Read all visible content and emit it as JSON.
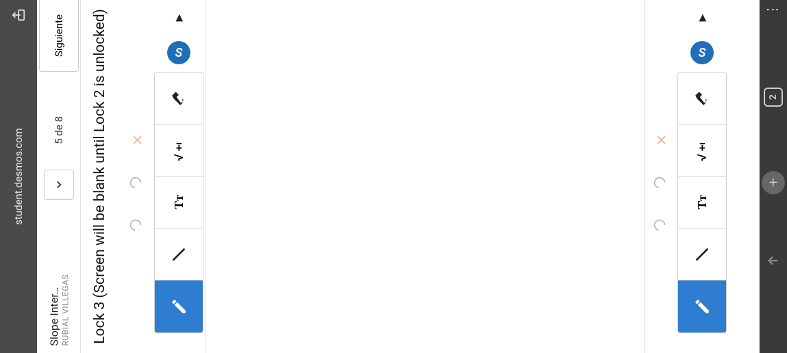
{
  "browser": {
    "url": "student.desmos.com",
    "share_icon": "share-icon"
  },
  "header": {
    "activity_title": "Slope Inter…",
    "teacher_name": "RUBIAL VILLEGAS",
    "page_count": "5 de 8",
    "next_label": "Siguiente",
    "chevron_icon": "chevron-down",
    "menu_icon": "more-dots"
  },
  "screen": {
    "title": "Lock 3 (Screen will be blank until Lock 2 is unlocked)"
  },
  "sketch_controls": {
    "close_icon": "close-x",
    "undo_icon": "undo-arc",
    "redo_icon": "redo-arc",
    "sketch_badge": "S",
    "play_icon": "play-triangle"
  },
  "toolbar": {
    "tools": [
      {
        "id": "eraser",
        "icon": "eraser-icon",
        "active": false
      },
      {
        "id": "math",
        "icon": "sqrt-pm-icon",
        "active": false
      },
      {
        "id": "text",
        "icon": "text-tt-icon",
        "active": false
      },
      {
        "id": "line",
        "icon": "line-icon",
        "active": false
      },
      {
        "id": "draw",
        "icon": "pencil-icon",
        "active": true
      }
    ]
  },
  "bottom_bar": {
    "more_icon": "more-vertical",
    "tab_badge": "2",
    "add_icon": "plus",
    "share_up_icon": "arrow-up"
  },
  "colors": {
    "accent_blue": "#2f7dd1",
    "badge_blue": "#1f6fb8",
    "close_salmon": "#f4a89a",
    "chrome_gray": "#4a4a4a"
  }
}
